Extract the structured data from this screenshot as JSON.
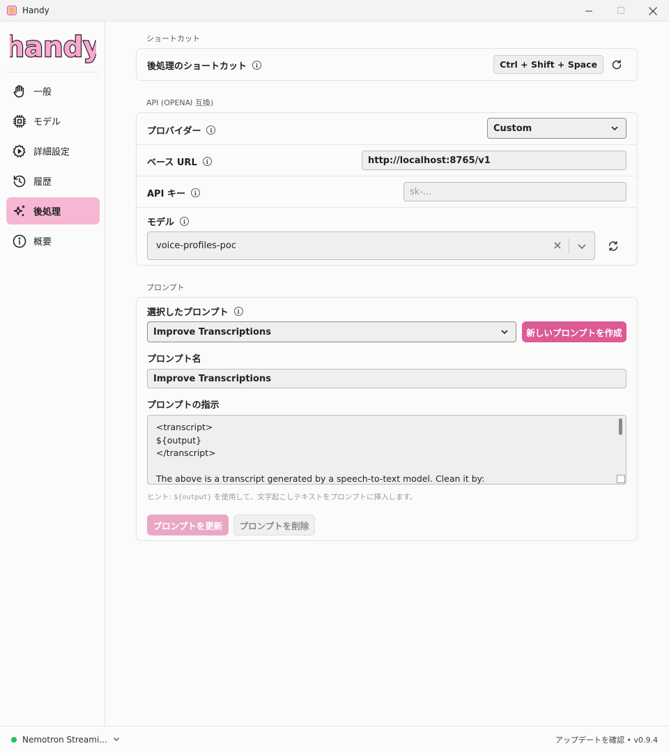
{
  "window": {
    "title": "Handy",
    "minimize": "─",
    "maximize": "☐",
    "close": "✕"
  },
  "sidebar": {
    "logo": "handy",
    "items": [
      {
        "label": "一般",
        "icon": "hand-icon",
        "active": false
      },
      {
        "label": "モデル",
        "icon": "chip-icon",
        "active": false
      },
      {
        "label": "詳細設定",
        "icon": "gear-icon",
        "active": false
      },
      {
        "label": "履歴",
        "icon": "history-icon",
        "active": false
      },
      {
        "label": "後処理",
        "icon": "sparkle-icon",
        "active": true
      },
      {
        "label": "概要",
        "icon": "info-icon",
        "active": false
      }
    ]
  },
  "shortcut_section": {
    "title": "ショートカット",
    "label": "後処理のショートカット",
    "key": "Ctrl + Shift + Space"
  },
  "api_section": {
    "title": "API (OPENAI 互換)",
    "provider_label": "プロバイダー",
    "provider_value": "Custom",
    "base_url_label": "ベース URL",
    "base_url_value": "http://localhost:8765/v1",
    "api_key_label": "API キー",
    "api_key_placeholder": "sk-...",
    "model_label": "モデル",
    "model_value": "voice-profiles-poc"
  },
  "prompt_section": {
    "title": "プロンプト",
    "selected_label": "選択したプロンプト",
    "selected_value": "Improve Transcriptions",
    "new_button": "新しいプロンプトを作成",
    "name_label": "プロンプト名",
    "name_value": "Improve Transcriptions",
    "instructions_label": "プロンプトの指示",
    "instructions_value": "<transcript>\n${output}\n</transcript>\n\nThe above is a transcript generated by a speech-to-text model. Clean it by:",
    "hint_prefix": "ヒント: ",
    "hint_code": "${output}",
    "hint_suffix": " を使用して、文字起こしテキストをプロンプトに挿入します。",
    "update_button": "プロンプトを更新",
    "delete_button": "プロンプトを削除"
  },
  "bottombar": {
    "model": "Nemotron Streami...",
    "update_text": "アップデートを確認 • v0.9.4"
  },
  "colors": {
    "accent": "#dc5a95",
    "active_nav": "#f7b6d3",
    "status": "#1fbf5b"
  }
}
